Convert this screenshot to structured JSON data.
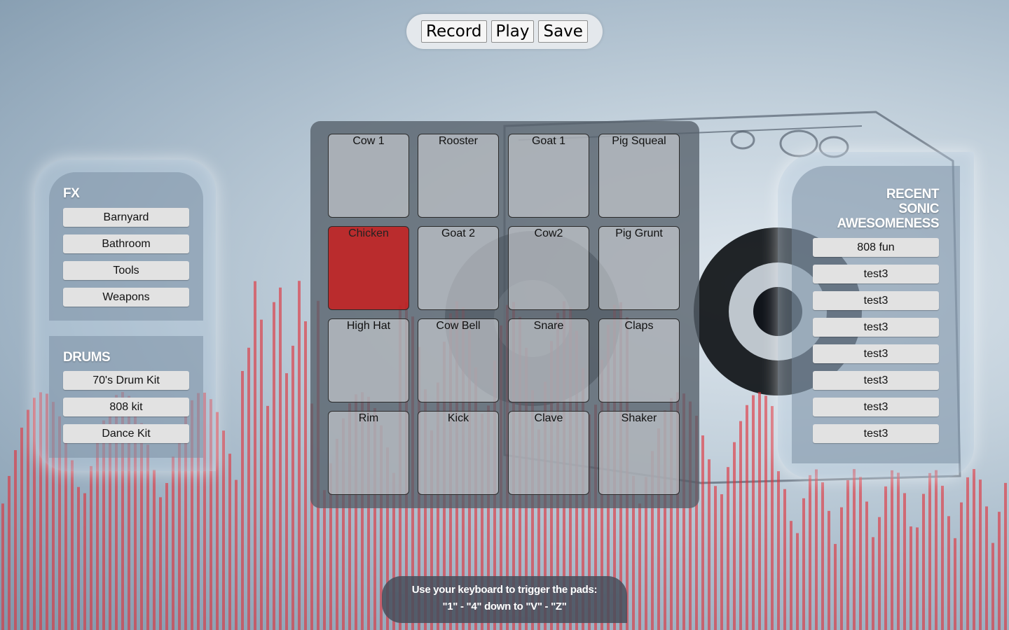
{
  "controls": {
    "record": "Record",
    "play": "Play",
    "save": "Save"
  },
  "fx": {
    "heading": "FX",
    "items": [
      "Barnyard",
      "Bathroom",
      "Tools",
      "Weapons"
    ]
  },
  "drums": {
    "heading": "DRUMS",
    "items": [
      "70's Drum Kit",
      "808 kit",
      "Dance Kit"
    ]
  },
  "recent": {
    "heading_lines": [
      "RECENT",
      "SONIC",
      "AWESOMENESS"
    ],
    "items": [
      "808 fun",
      "test3",
      "test3",
      "test3",
      "test3",
      "test3",
      "test3",
      "test3"
    ]
  },
  "pads": [
    {
      "label": "Cow 1",
      "active": false
    },
    {
      "label": "Rooster",
      "active": false
    },
    {
      "label": "Goat 1",
      "active": false
    },
    {
      "label": "Pig Squeal",
      "active": false
    },
    {
      "label": "Chicken",
      "active": true
    },
    {
      "label": "Goat 2",
      "active": false
    },
    {
      "label": "Cow2",
      "active": false
    },
    {
      "label": "Pig Grunt",
      "active": false
    },
    {
      "label": "High Hat",
      "active": false
    },
    {
      "label": "Cow Bell",
      "active": false
    },
    {
      "label": "Snare",
      "active": false
    },
    {
      "label": "Claps",
      "active": false
    },
    {
      "label": "Rim",
      "active": false
    },
    {
      "label": "Kick",
      "active": false
    },
    {
      "label": "Clave",
      "active": false
    },
    {
      "label": "Shaker",
      "active": false
    }
  ],
  "instructions": {
    "line1": "Use your keyboard to trigger the pads:",
    "line2": "\"1\" - \"4\" down to \"V\" - \"Z\""
  },
  "colors": {
    "active_pad": "#c81e1e",
    "visualizer": "#e0303a"
  }
}
